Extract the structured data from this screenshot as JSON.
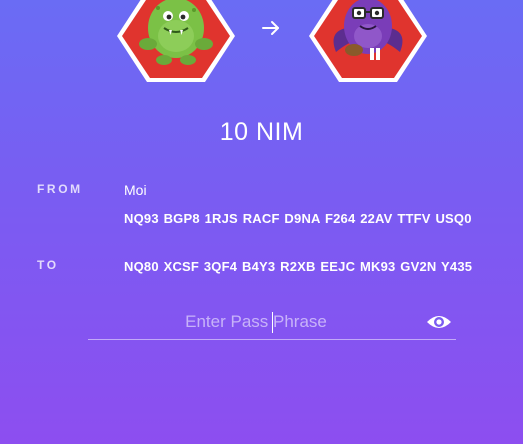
{
  "transaction": {
    "amount": "10 NIM"
  },
  "sender": {
    "label": "FROM",
    "name": "Moi",
    "address": "NQ93 BGP8 1RJS RACF D9NA F264 22AV TTFV USQ0",
    "avatar_icon": "green-monster-identicon"
  },
  "recipient": {
    "label": "TO",
    "address": "NQ80 XCSF 3QF4 B4Y3 R2XB EEJC MK93 GV2N Y435",
    "avatar_icon": "purple-monster-identicon"
  },
  "arrow_icon": "arrow-right-icon",
  "passphrase": {
    "placeholder": "Enter Pass Phrase",
    "value": "",
    "toggle_icon": "eye-icon"
  },
  "colors": {
    "background_top": "#6a6cf4",
    "background_bottom": "#8d4ef0",
    "hexagon_red": "#e0342e",
    "monster_green": "#7bc146",
    "monster_purple": "#7a3db8"
  }
}
